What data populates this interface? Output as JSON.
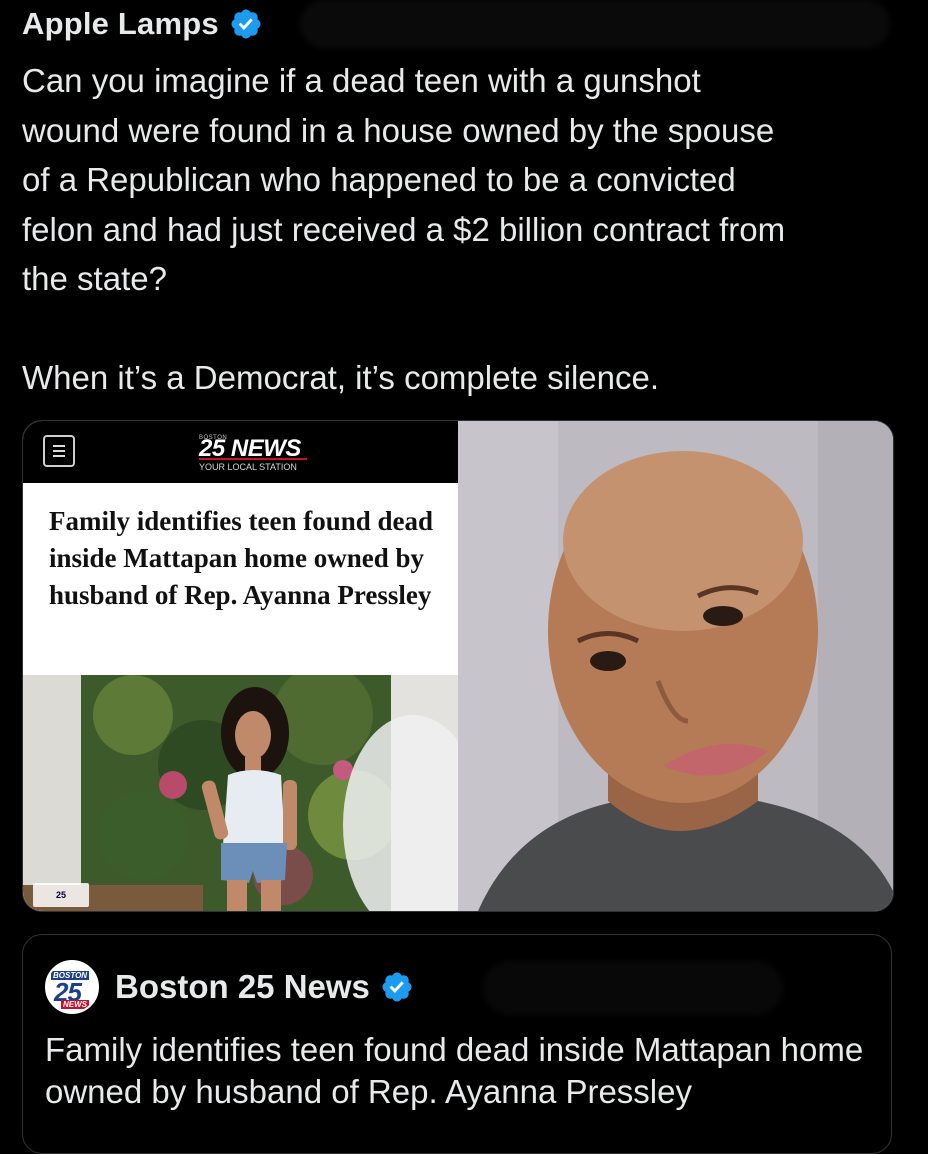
{
  "tweet": {
    "author_name": "Apple Lamps",
    "text": "Can you imagine if a dead teen with a gunshot\nwound were found in a house owned by the spouse\nof a Republican who happened to be a convicted\nfelon and had just received a $2 billion contract from\nthe state?\n\nWhen it’s a Democrat, it’s complete silence."
  },
  "media": {
    "news_logo_top": "BOSTON",
    "news_logo_main": "25 NEWS",
    "news_logo_sub": "YOUR LOCAL STATION",
    "headline": "Family identifies teen found dead inside Mattapan home owned by husband of Rep. Ayanna Pressley",
    "photo_logo": "25"
  },
  "quoted_tweet": {
    "avatar_top": "BOSTON",
    "avatar_num": "25",
    "avatar_bottom": "NEWS",
    "author_name": "Boston 25 News",
    "text": "Family identifies teen found dead inside Mattapan home owned by husband of Rep. Ayanna Pressley"
  },
  "colors": {
    "background": "#000000",
    "text": "#e7e9ea",
    "verified_blue": "#1d9bf0",
    "border": "#2f3336",
    "brand_red": "#c8102e"
  },
  "icons": [
    "verified-badge-icon",
    "menu-icon"
  ]
}
